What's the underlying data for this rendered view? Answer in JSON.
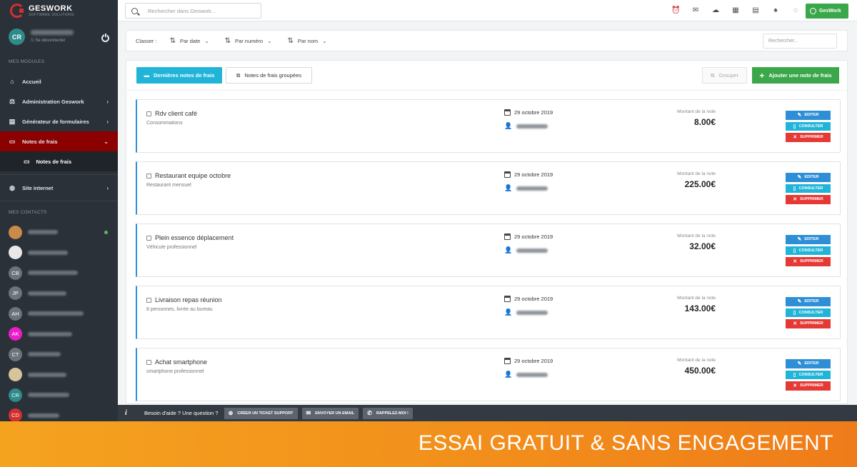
{
  "app": {
    "logo_text": "GESWORK",
    "logo_sub": "SOFTWARE SOLUTIONS"
  },
  "user": {
    "initials": "CR",
    "logout": "Se déconnecter"
  },
  "sidebar": {
    "modules_title": "MES MODULES",
    "items": [
      {
        "label": "Accueil",
        "icon": "home-icon",
        "glyph": "⌂"
      },
      {
        "label": "Administration Geswork",
        "icon": "gavel-icon",
        "glyph": "⚖"
      },
      {
        "label": "Générateur de formulaires",
        "icon": "form-icon",
        "glyph": "▤"
      },
      {
        "label": "Notes de frais",
        "icon": "store-icon",
        "glyph": "▭"
      },
      {
        "label": "Notes de frais",
        "icon": "store-icon",
        "glyph": "▭"
      },
      {
        "label": "Site internet",
        "icon": "globe-icon",
        "glyph": "◍"
      }
    ],
    "contacts_title": "MES CONTACTS",
    "contacts": [
      {
        "initials": "",
        "color": "#c98a4b"
      },
      {
        "initials": "",
        "color": "#e8e8e8"
      },
      {
        "initials": "CB",
        "color": "#6b737b"
      },
      {
        "initials": "JP",
        "color": "#6b737b"
      },
      {
        "initials": "AH",
        "color": "#6b737b"
      },
      {
        "initials": "AK",
        "color": "#e91ec8"
      },
      {
        "initials": "CT",
        "color": "#6b737b"
      },
      {
        "initials": "",
        "color": "#d8c49a"
      },
      {
        "initials": "CR",
        "color": "#2e8b8a"
      },
      {
        "initials": "CD",
        "color": "#d32f2f"
      }
    ]
  },
  "topbar": {
    "search_placeholder": "Rechercher dans Geswork...",
    "icons": [
      "alarm-icon",
      "mail-icon",
      "cloud-icon",
      "calendar-icon",
      "grid-icon",
      "bell-icon",
      "chat-icon"
    ],
    "brand_button": "GesWork"
  },
  "filter": {
    "label": "Classer :",
    "sort_date": "Par date",
    "sort_number": "Par numéro",
    "sort_name": "Par nom",
    "search_placeholder": "Rechercher..."
  },
  "actions": {
    "recent": "Dernières notes de frais",
    "grouped": "Notes de frais groupées",
    "grouper": "Grouper",
    "add": "Ajouter une note de frais"
  },
  "notes": [
    {
      "title": "Rdv client café",
      "subtitle": "Consommations",
      "date": "29 octobre 2019",
      "amount_label": "Montant de la note",
      "amount": "8.00€"
    },
    {
      "title": "Restaurant equipe octobre",
      "subtitle": "Restaurant mensuel",
      "date": "29 octobre 2019",
      "amount_label": "Montant de la note",
      "amount": "225.00€"
    },
    {
      "title": "Plein essence déplacement",
      "subtitle": "Véhicule professionnel",
      "date": "29 octobre 2019",
      "amount_label": "Montant de la note",
      "amount": "32.00€"
    },
    {
      "title": "Livraison repas réunion",
      "subtitle": "8 personnes, livrée au bureau",
      "date": "29 octobre 2019",
      "amount_label": "Montant de la note",
      "amount": "143.00€"
    },
    {
      "title": "Achat smartphone",
      "subtitle": "smartphone professionnel",
      "date": "29 octobre 2019",
      "amount_label": "Montant de la note",
      "amount": "450.00€"
    }
  ],
  "note_buttons": {
    "edit": "EDITER",
    "view": "CONSULTER",
    "delete": "SUPPRIMER"
  },
  "help": {
    "text": "Besoin d'aide ? Une question ?",
    "ticket": "CRÉER UN TICKET SUPPORT",
    "email": "ENVOYER UN EMAIL",
    "call": "RAPPELEZ-MOI !"
  },
  "banner": {
    "text": "ESSAI GRATUIT & SANS ENGAGEMENT"
  },
  "colors": {
    "sidebar_bg": "#2b3138",
    "active_nav": "#8b0000",
    "primary_blue": "#2f8fd6",
    "cyan": "#20b4d8",
    "green": "#3aa84a",
    "red": "#e53935",
    "banner_orange": "#f28d1b"
  }
}
